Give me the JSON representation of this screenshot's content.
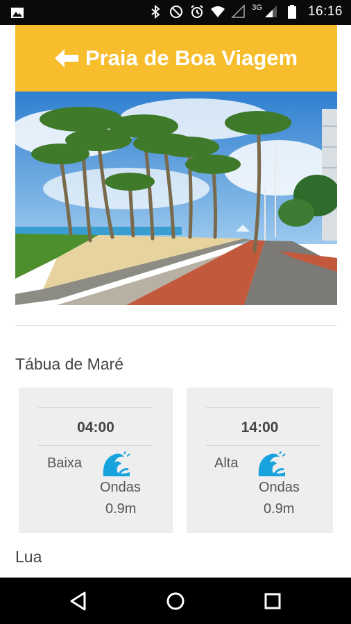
{
  "status_bar": {
    "network_label": "3G",
    "time": "16:16"
  },
  "header": {
    "title": "Praia de Boa Viagem",
    "background_color": "#f7bd2c"
  },
  "tide_section": {
    "title": "Tábua de Maré",
    "cards": [
      {
        "time": "04:00",
        "type": "Baixa",
        "waves_label": "Ondas",
        "height": "0.9m"
      },
      {
        "time": "14:00",
        "type": "Alta",
        "waves_label": "Ondas",
        "height": "0.9m"
      }
    ]
  },
  "moon_section": {
    "title": "Lua"
  },
  "nav_bar": {
    "icons": [
      "back-triangle-icon",
      "home-circle-icon",
      "recents-square-icon"
    ]
  }
}
